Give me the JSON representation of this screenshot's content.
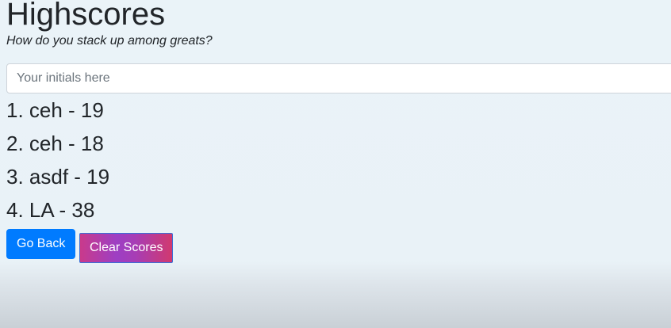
{
  "header": {
    "title": "Highscores",
    "subtitle": "How do you stack up among greats?"
  },
  "initials_input": {
    "placeholder": "Your initials here",
    "value": ""
  },
  "scores": [
    "1. ceh - 19",
    "2. ceh - 18",
    "3. asdf - 19",
    "4. LA - 38"
  ],
  "buttons": {
    "go_back": "Go Back",
    "clear_scores": "Clear Scores"
  },
  "colors": {
    "primary": "#007bff",
    "gradient_start": "#c93a8b",
    "gradient_mid": "#9d3fc4",
    "gradient_end": "#d1396f",
    "page_background": "#eaf3f8"
  }
}
